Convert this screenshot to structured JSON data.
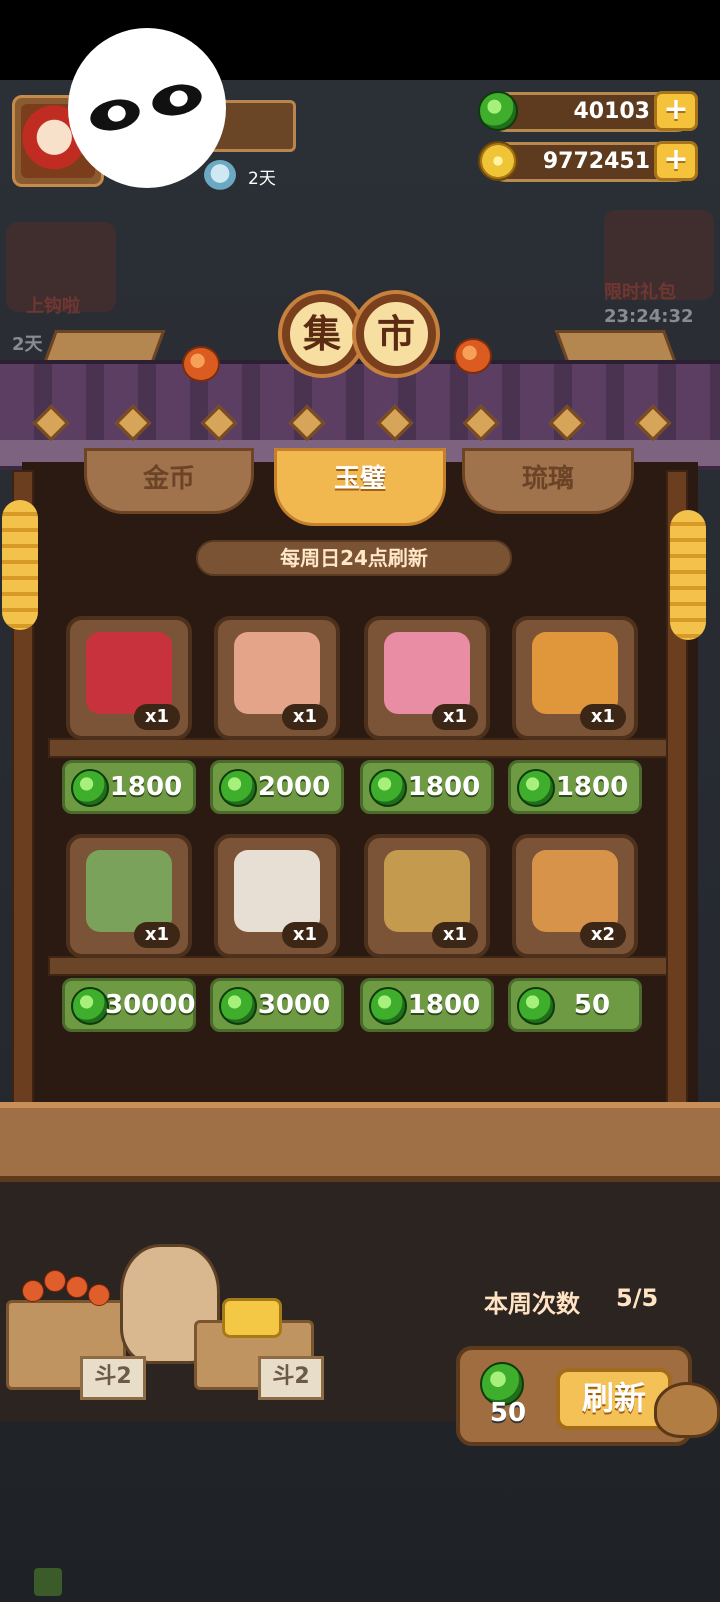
{
  "header": {
    "days_left": "2天",
    "jade_balance": "40103",
    "coin_balance": "9772451"
  },
  "side_events": {
    "left_label": "上钩啦",
    "left_days": "2天",
    "right_label": "限时礼包",
    "right_timer": "23:24:32"
  },
  "title": {
    "char1": "集",
    "char2": "市"
  },
  "tabs": [
    {
      "label": "金币",
      "active": false
    },
    {
      "label": "玉璧",
      "active": true
    },
    {
      "label": "琉璃",
      "active": false
    }
  ],
  "refresh_note": "每周日24点刷新",
  "items": [
    {
      "name": "red-mount-item",
      "qty": "x1",
      "price": "1800",
      "color": "#c8323c"
    },
    {
      "name": "girl-character-item",
      "qty": "x1",
      "price": "2000",
      "color": "#e4a489"
    },
    {
      "name": "flower-bouquet-item",
      "qty": "x1",
      "price": "1800",
      "color": "#e88da4"
    },
    {
      "name": "golden-pot-item",
      "qty": "x1",
      "price": "1800",
      "color": "#e0973b"
    },
    {
      "name": "green-hat-character-item",
      "qty": "x1",
      "price": "30000",
      "color": "#7aa25a"
    },
    {
      "name": "white-hair-character-item",
      "qty": "x1",
      "price": "3000",
      "color": "#e8dfd4"
    },
    {
      "name": "treasure-chest-item",
      "qty": "x1",
      "price": "1800",
      "color": "#c49a4e"
    },
    {
      "name": "rice-dumpling-item",
      "qty": "x2",
      "price": "50",
      "color": "#d8934a"
    }
  ],
  "bottom": {
    "week_label": "本周次数",
    "week_value": "5/5",
    "refresh_cost": "50",
    "refresh_label": "刷新",
    "sign_text": "斗2"
  }
}
